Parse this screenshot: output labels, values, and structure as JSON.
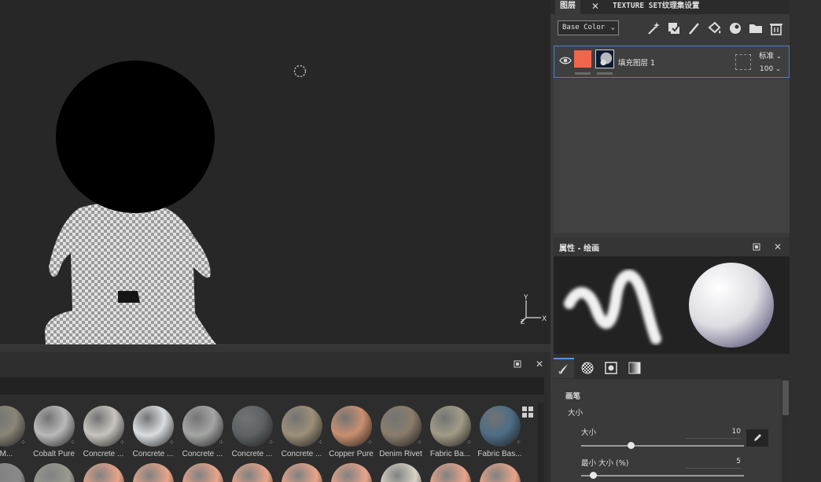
{
  "tabs": {
    "layers": "图层",
    "close": "✕",
    "texture_set": "TEXTURE SET纹理集设置"
  },
  "layers_toolbar": {
    "channel": "Base Color",
    "tools": [
      "magic-wand-icon",
      "add-layer-icon",
      "paint-icon",
      "fill-icon",
      "smart-material-icon",
      "folder-icon",
      "trash-icon"
    ]
  },
  "layer": {
    "name": "填充图层 1",
    "blend_mode": "标准",
    "opacity": "100",
    "color": "#f2654d"
  },
  "properties": {
    "title": "属性 - 绘画",
    "section": "画笔",
    "size_group": "大小",
    "size_label": "大小",
    "size_value": "10",
    "min_size_label": "最小 大小 (%)",
    "min_size_value": "5"
  },
  "shelf": {
    "materials": [
      {
        "name": "l M...",
        "color": "#8a8577"
      },
      {
        "name": "Cobalt Pure",
        "color": "#b9b9b9"
      },
      {
        "name": "Concrete ...",
        "color": "#c6c4bd"
      },
      {
        "name": "Concrete ...",
        "color": "#d9dde0"
      },
      {
        "name": "Concrete ...",
        "color": "#a4a6a4"
      },
      {
        "name": "Concrete ...",
        "color": "#5e6264"
      },
      {
        "name": "Concrete ...",
        "color": "#9b8f78"
      },
      {
        "name": "Copper Pure",
        "color": "#c98f6f"
      },
      {
        "name": "Denim Rivet",
        "color": "#8a7d6c"
      },
      {
        "name": "Fabric Ba...",
        "color": "#a19b86"
      },
      {
        "name": "Fabric Bas...",
        "color": "#4d6d85"
      }
    ],
    "row2_colors": [
      "#8a8a8a",
      "#9a9a90",
      "#e8a489",
      "#e8a489",
      "#e8a489",
      "#e8a489",
      "#e8a489",
      "#e8a489",
      "#d8d2c4",
      "#e8a489",
      "#e8a489"
    ]
  }
}
